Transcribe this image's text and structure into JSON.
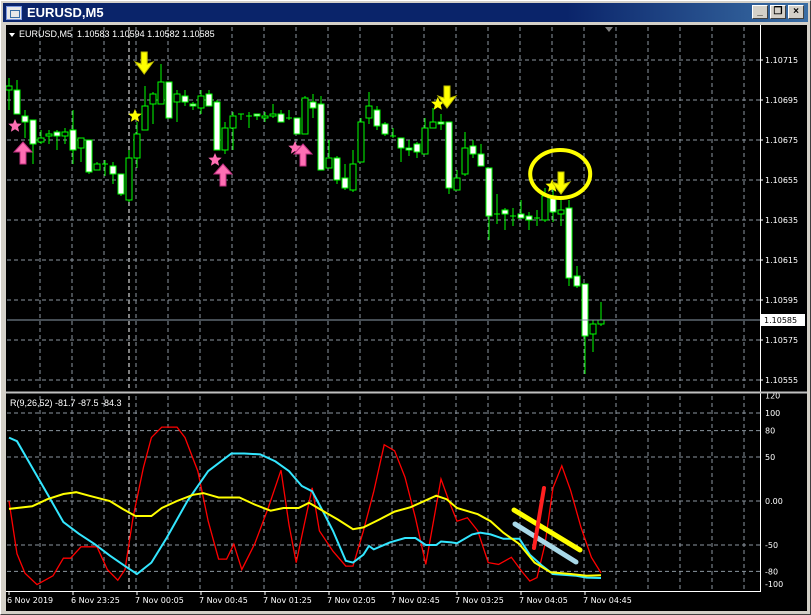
{
  "window": {
    "title": "EURUSD,M5",
    "buttons": [
      "minimize",
      "restore",
      "close"
    ]
  },
  "chart": {
    "symbol_header": "EURUSD,M5",
    "ohlc_header": "1.10583 1.10594 1.10582 1.10585",
    "current_price": 1.10585,
    "current_price_label": "1.10585",
    "price_labels": [
      "1.10715",
      "1.10695",
      "1.10675",
      "1.10655",
      "1.10635",
      "1.10615",
      "1.10595",
      "1.10575",
      "1.10555"
    ],
    "time_labels": [
      "6 Nov 2019",
      "6 Nov 23:25",
      "7 Nov 00:05",
      "7 Nov 00:45",
      "7 Nov 01:25",
      "7 Nov 02:05",
      "7 Nov 02:45",
      "7 Nov 03:25",
      "7 Nov 04:05",
      "7 Nov 04:45"
    ],
    "colors": {
      "background": "#000000",
      "grid": "#8c96a0",
      "candle": "#00ff00",
      "bear_fill": "#ffffff",
      "buy_signal": "#ff6fb4",
      "sell_signal": "#ffff00"
    },
    "candles": [
      [
        1.107,
        1.10706,
        1.1069,
        1.10702
      ],
      [
        1.107,
        1.10705,
        1.10688,
        1.10688
      ],
      [
        1.10687,
        1.1069,
        1.10676,
        1.10684
      ],
      [
        1.10685,
        1.10685,
        1.10663,
        1.10673
      ],
      [
        1.10674,
        1.1068,
        1.10673,
        1.10676
      ],
      [
        1.10677,
        1.1068,
        1.10673,
        1.10678
      ],
      [
        1.10679,
        1.1068,
        1.1067,
        1.10677
      ],
      [
        1.10677,
        1.10681,
        1.10673,
        1.10679
      ],
      [
        1.1068,
        1.1069,
        1.10663,
        1.1067
      ],
      [
        1.10671,
        1.10676,
        1.10664,
        1.10676
      ],
      [
        1.10675,
        1.10675,
        1.10658,
        1.10659
      ],
      [
        1.1066,
        1.10664,
        1.1066,
        1.10663
      ],
      [
        1.10663,
        1.10665,
        1.10657,
        1.10663
      ],
      [
        1.10662,
        1.10664,
        1.10653,
        1.10658
      ],
      [
        1.10658,
        1.10658,
        1.10647,
        1.10648
      ],
      [
        1.10645,
        1.1067,
        1.10644,
        1.10666
      ],
      [
        1.10666,
        1.10684,
        1.10661,
        1.10678
      ],
      [
        1.1068,
        1.10702,
        1.1068,
        1.10692
      ],
      [
        1.10693,
        1.10699,
        1.10683,
        1.10698
      ],
      [
        1.10693,
        1.10713,
        1.10693,
        1.10704
      ],
      [
        1.10704,
        1.10704,
        1.10686,
        1.10686
      ],
      [
        1.10694,
        1.107,
        1.10684,
        1.10698
      ],
      [
        1.10697,
        1.107,
        1.10692,
        1.10694
      ],
      [
        1.10693,
        1.10694,
        1.1069,
        1.10692
      ],
      [
        1.10691,
        1.107,
        1.10688,
        1.10697
      ],
      [
        1.10698,
        1.107,
        1.10692,
        1.10692
      ],
      [
        1.10694,
        1.10695,
        1.1067,
        1.1067
      ],
      [
        1.1067,
        1.10684,
        1.10668,
        1.10681
      ],
      [
        1.10681,
        1.10689,
        1.1067,
        1.10687
      ],
      [
        1.10688,
        1.10688,
        1.10685,
        1.10688
      ],
      [
        1.10687,
        1.10689,
        1.10681,
        1.10687
      ],
      [
        1.10688,
        1.10688,
        1.10685,
        1.10687
      ],
      [
        1.10686,
        1.10689,
        1.10684,
        1.10687
      ],
      [
        1.10687,
        1.10693,
        1.10686,
        1.10688
      ],
      [
        1.10688,
        1.1069,
        1.10684,
        1.10684
      ],
      [
        1.10686,
        1.1069,
        1.10685,
        1.10686
      ],
      [
        1.10686,
        1.10686,
        1.10678,
        1.10678
      ],
      [
        1.10678,
        1.10697,
        1.10678,
        1.10696
      ],
      [
        1.10694,
        1.10698,
        1.10686,
        1.10691
      ],
      [
        1.10693,
        1.10697,
        1.1066,
        1.1066
      ],
      [
        1.10661,
        1.10675,
        1.10661,
        1.10666
      ],
      [
        1.10666,
        1.10667,
        1.10653,
        1.10655
      ],
      [
        1.10656,
        1.10663,
        1.1065,
        1.10651
      ],
      [
        1.1065,
        1.1067,
        1.10649,
        1.10663
      ],
      [
        1.10664,
        1.10686,
        1.10664,
        1.10684
      ],
      [
        1.10686,
        1.10699,
        1.10683,
        1.10692
      ],
      [
        1.1069,
        1.10692,
        1.1068,
        1.10682
      ],
      [
        1.10683,
        1.10684,
        1.10677,
        1.10678
      ],
      [
        1.10677,
        1.10681,
        1.10676,
        1.10677
      ],
      [
        1.10676,
        1.10676,
        1.10664,
        1.10671
      ],
      [
        1.10671,
        1.10675,
        1.10667,
        1.1067
      ],
      [
        1.10673,
        1.10674,
        1.10666,
        1.10669
      ],
      [
        1.10668,
        1.10686,
        1.10668,
        1.10681
      ],
      [
        1.10681,
        1.10691,
        1.10681,
        1.10684
      ],
      [
        1.10684,
        1.10688,
        1.1068,
        1.10683
      ],
      [
        1.10684,
        1.10684,
        1.10648,
        1.10651
      ],
      [
        1.1065,
        1.1066,
        1.1065,
        1.10656
      ],
      [
        1.10658,
        1.10679,
        1.10657,
        1.10671
      ],
      [
        1.10672,
        1.10675,
        1.10666,
        1.10668
      ],
      [
        1.10668,
        1.10673,
        1.10662,
        1.10662
      ],
      [
        1.10661,
        1.10661,
        1.10625,
        1.10637
      ],
      [
        1.10638,
        1.10648,
        1.10633,
        1.10638
      ],
      [
        1.1064,
        1.10641,
        1.1063,
        1.10638
      ],
      [
        1.10637,
        1.10641,
        1.10632,
        1.10637
      ],
      [
        1.10638,
        1.10645,
        1.10636,
        1.10636
      ],
      [
        1.10637,
        1.10639,
        1.1063,
        1.10635
      ],
      [
        1.10636,
        1.1064,
        1.10632,
        1.10636
      ],
      [
        1.10635,
        1.10651,
        1.10634,
        1.10647
      ],
      [
        1.10647,
        1.10651,
        1.10634,
        1.10639
      ],
      [
        1.10638,
        1.10645,
        1.10632,
        1.1064
      ],
      [
        1.10641,
        1.10645,
        1.10602,
        1.10606
      ],
      [
        1.10607,
        1.10612,
        1.10601,
        1.10602
      ],
      [
        1.10603,
        1.10603,
        1.10558,
        1.10577
      ],
      [
        1.10578,
        1.10585,
        1.10569,
        1.10583
      ],
      [
        1.10583,
        1.10594,
        1.10582,
        1.10585
      ]
    ],
    "signals": [
      {
        "type": "buy-star",
        "bar": 0.75,
        "price": 1.10682
      },
      {
        "type": "buy-arrow",
        "bar": 1.75,
        "price": 1.10669
      },
      {
        "type": "sell-star",
        "bar": 15.75,
        "price": 1.10687
      },
      {
        "type": "sell-arrow",
        "bar": 16.9,
        "price": 1.10713
      },
      {
        "type": "buy-star",
        "bar": 25.75,
        "price": 1.10665
      },
      {
        "type": "buy-arrow",
        "bar": 26.75,
        "price": 1.10658
      },
      {
        "type": "buy-star",
        "bar": 35.75,
        "price": 1.10671
      },
      {
        "type": "buy-arrow",
        "bar": 36.75,
        "price": 1.10668
      },
      {
        "type": "sell-star",
        "bar": 53.6,
        "price": 1.10693
      },
      {
        "type": "sell-arrow",
        "bar": 54.75,
        "price": 1.10696
      },
      {
        "type": "sell-star",
        "bar": 67.9,
        "price": 1.10652
      },
      {
        "type": "sell-arrow",
        "bar": 69,
        "price": 1.10653
      }
    ],
    "highlight_circle": {
      "bar": 68.9,
      "price": 1.10658
    }
  },
  "indicator": {
    "header": "R(9,26,52) -81.7 -87.5 -84.3",
    "labels": [
      "120",
      "100",
      "80",
      "50",
      "0.00",
      "-50",
      "-80",
      "-100"
    ],
    "label_values": [
      120,
      100,
      80,
      50,
      0,
      -50,
      -80,
      -100
    ],
    "grid_values": [
      100,
      80,
      50,
      0,
      -50,
      -80
    ],
    "series": [
      {
        "name": "fast",
        "color": "#ff0000",
        "points": [
          [
            0,
            0
          ],
          [
            1,
            -60
          ],
          [
            2,
            -82
          ],
          [
            3.5,
            -95
          ],
          [
            5.5,
            -85
          ],
          [
            6.8,
            -65
          ],
          [
            7.7,
            -65
          ],
          [
            9,
            -52
          ],
          [
            11,
            -52
          ],
          [
            12.3,
            -78
          ],
          [
            13.6,
            -90
          ],
          [
            14.5,
            -78
          ],
          [
            15.5,
            -19
          ],
          [
            16.8,
            38
          ],
          [
            17.8,
            72
          ],
          [
            19.1,
            84
          ],
          [
            21,
            84
          ],
          [
            22,
            72
          ],
          [
            23.6,
            34
          ],
          [
            24.9,
            -23
          ],
          [
            26.2,
            -66
          ],
          [
            27.2,
            -66
          ],
          [
            28.1,
            -49
          ],
          [
            29.1,
            -78
          ],
          [
            30.7,
            -49
          ],
          [
            32.4,
            -8
          ],
          [
            34,
            35
          ],
          [
            35,
            -27
          ],
          [
            35.9,
            -70
          ],
          [
            36.9,
            -27
          ],
          [
            37.9,
            15
          ],
          [
            38.8,
            -34
          ],
          [
            40.5,
            -57
          ],
          [
            42.1,
            -74
          ],
          [
            43,
            -74
          ],
          [
            44.3,
            -34
          ],
          [
            45.6,
            11
          ],
          [
            46.9,
            64
          ],
          [
            48.2,
            57
          ],
          [
            49.5,
            27
          ],
          [
            50.8,
            -19
          ],
          [
            52.1,
            -72
          ],
          [
            54,
            25
          ],
          [
            55,
            0
          ],
          [
            56,
            -23
          ],
          [
            57.3,
            -19
          ],
          [
            58.6,
            -34
          ],
          [
            59.9,
            -70
          ],
          [
            61.2,
            -72
          ],
          [
            62.8,
            -64
          ],
          [
            64.1,
            -80
          ],
          [
            65.1,
            -91
          ],
          [
            66,
            -87
          ],
          [
            67,
            -49
          ],
          [
            68,
            15
          ],
          [
            69.1,
            40
          ],
          [
            70.2,
            12
          ],
          [
            71.5,
            -30
          ],
          [
            72.8,
            -64
          ],
          [
            74,
            -81.7
          ]
        ]
      },
      {
        "name": "medium",
        "color": "#33e6ff",
        "points": [
          [
            0,
            72
          ],
          [
            1,
            68
          ],
          [
            2.9,
            38
          ],
          [
            4.8,
            8
          ],
          [
            6.8,
            -24
          ],
          [
            8.7,
            -37
          ],
          [
            10.7,
            -49
          ],
          [
            12.6,
            -62
          ],
          [
            14.5,
            -74
          ],
          [
            16,
            -83
          ],
          [
            17.8,
            -70
          ],
          [
            19.7,
            -42
          ],
          [
            22.3,
            0
          ],
          [
            24.9,
            34
          ],
          [
            27.8,
            54
          ],
          [
            29.4,
            54
          ],
          [
            31.4,
            53
          ],
          [
            33.3,
            45
          ],
          [
            35,
            34
          ],
          [
            36.6,
            17
          ],
          [
            37.9,
            11
          ],
          [
            39.2,
            -11
          ],
          [
            40.5,
            -34
          ],
          [
            42.1,
            -68
          ],
          [
            43,
            -70
          ],
          [
            44.3,
            -61
          ],
          [
            45,
            -51
          ],
          [
            45.6,
            -55
          ],
          [
            47.6,
            -47
          ],
          [
            49.5,
            -42
          ],
          [
            50.8,
            -42
          ],
          [
            52.1,
            -50
          ],
          [
            53.4,
            -50
          ],
          [
            54,
            -46
          ],
          [
            55.3,
            -47
          ],
          [
            56,
            -48
          ],
          [
            57.9,
            -38
          ],
          [
            58.9,
            -36
          ],
          [
            60.2,
            -38
          ],
          [
            61.8,
            -43
          ],
          [
            63.8,
            -43
          ],
          [
            65.1,
            -61
          ],
          [
            66.7,
            -74
          ],
          [
            68,
            -83
          ],
          [
            70.9,
            -85
          ],
          [
            72.2,
            -87
          ],
          [
            74,
            -87.5
          ]
        ]
      },
      {
        "name": "slow",
        "color": "#ffff00",
        "points": [
          [
            0,
            -9
          ],
          [
            2.9,
            -6
          ],
          [
            4.8,
            2
          ],
          [
            6.8,
            8
          ],
          [
            8.4,
            10
          ],
          [
            10,
            6
          ],
          [
            12.6,
            0
          ],
          [
            14.2,
            -9
          ],
          [
            15.8,
            -17
          ],
          [
            17.8,
            -17
          ],
          [
            19.1,
            -8
          ],
          [
            21,
            0
          ],
          [
            23,
            7
          ],
          [
            24.3,
            9
          ],
          [
            26.2,
            4
          ],
          [
            28.8,
            4
          ],
          [
            30.7,
            -4
          ],
          [
            32.7,
            -11
          ],
          [
            34.3,
            -8
          ],
          [
            36.2,
            -8
          ],
          [
            37.5,
            -2
          ],
          [
            39.2,
            -11
          ],
          [
            41.1,
            -21
          ],
          [
            43,
            -32
          ],
          [
            44.3,
            -30
          ],
          [
            46.3,
            -21
          ],
          [
            48.2,
            -12
          ],
          [
            50.2,
            -7
          ],
          [
            53.4,
            6
          ],
          [
            54.7,
            2
          ],
          [
            56,
            -8
          ],
          [
            58.6,
            -15
          ],
          [
            60.2,
            -23
          ],
          [
            61.8,
            -36
          ],
          [
            63.8,
            -49
          ],
          [
            65.7,
            -70
          ],
          [
            67.7,
            -81
          ],
          [
            70.2,
            -83
          ],
          [
            72.2,
            -85
          ],
          [
            74,
            -84.3
          ]
        ]
      }
    ]
  }
}
